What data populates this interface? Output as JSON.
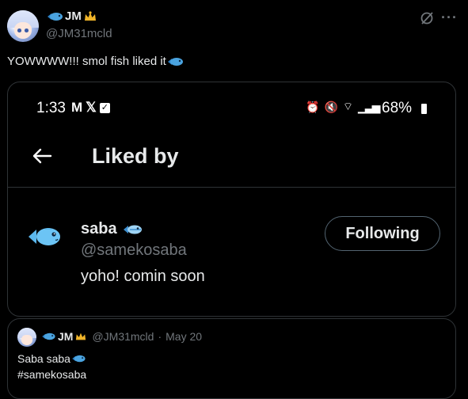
{
  "post": {
    "author_name": "JM",
    "author_handle": "@JM31mcld",
    "text": "YOWWWW!!! smol fish liked it"
  },
  "screenshot": {
    "status_time": "1:33",
    "battery": "68%",
    "page_title": "Liked by",
    "user_name": "saba",
    "user_handle": "@samekosaba",
    "user_bio": "yoho! comin soon",
    "follow_button": "Following"
  },
  "quoted": {
    "author_name": "JM",
    "author_handle": "@JM31mcld",
    "date": "May 20",
    "line1": "Saba saba",
    "line2": "#samekosaba"
  },
  "colors": {
    "fish_blue": "#4aa3df",
    "accent_gold": "#f0b429",
    "border": "#2f3336",
    "muted": "#71767b"
  },
  "icons": [
    "grok-icon",
    "more-icon",
    "back-arrow-icon",
    "fish-icon",
    "crown-icon",
    "alarm-icon",
    "mute-icon",
    "wifi-icon",
    "signal-icon",
    "battery-icon"
  ]
}
